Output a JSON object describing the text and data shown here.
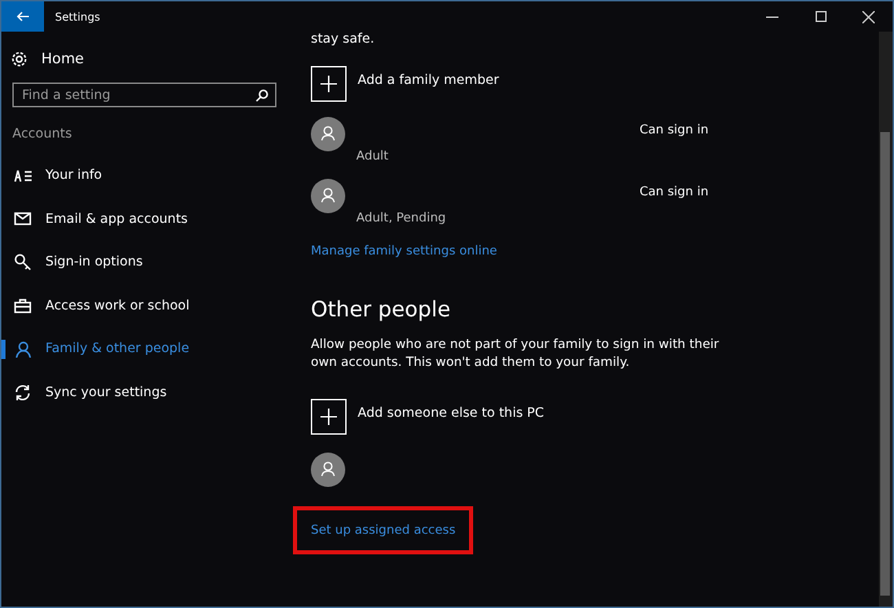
{
  "window": {
    "title": "Settings"
  },
  "sidebar": {
    "home": "Home",
    "search": {
      "placeholder": "Find a setting"
    },
    "section": "Accounts",
    "items": [
      {
        "label": "Your info",
        "selected": false
      },
      {
        "label": "Email & app accounts",
        "selected": false
      },
      {
        "label": "Sign-in options",
        "selected": false
      },
      {
        "label": "Access work or school",
        "selected": false
      },
      {
        "label": "Family & other people",
        "selected": true
      },
      {
        "label": "Sync your settings",
        "selected": false
      }
    ]
  },
  "family": {
    "intro_tail": "stay safe.",
    "add_label": "Add a family member",
    "members": [
      {
        "subtitle": "Adult",
        "status": "Can sign in"
      },
      {
        "subtitle": "Adult, Pending",
        "status": "Can sign in"
      }
    ],
    "manage_link": "Manage family settings online"
  },
  "other_people": {
    "heading": "Other people",
    "description": "Allow people who are not part of your family to sign in with their own accounts. This won't add them to your family.",
    "add_label": "Add someone else to this PC",
    "accounts": [
      {
        "kind": "user"
      }
    ],
    "assigned_access_link": {
      "label": "Set up assigned access",
      "highlighted": true
    }
  }
}
